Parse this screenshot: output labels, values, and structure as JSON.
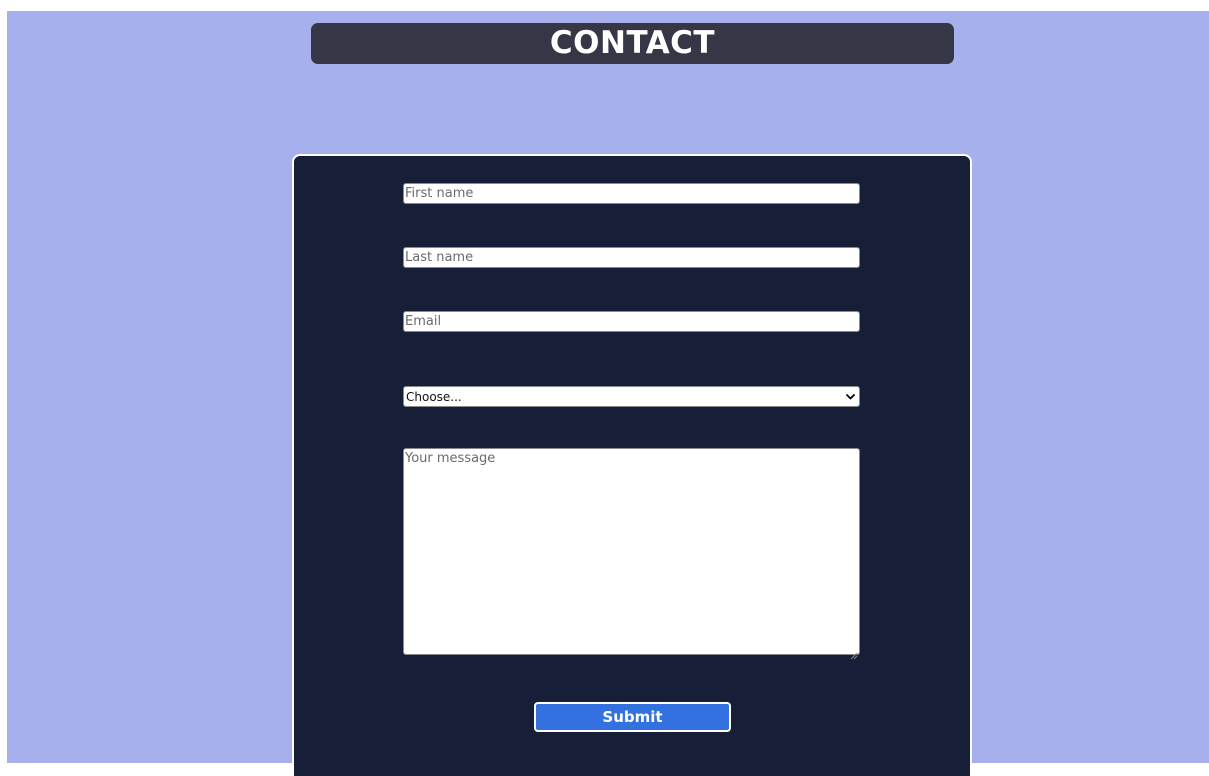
{
  "header": {
    "title": "CONTACT"
  },
  "form": {
    "first_name_placeholder": "First name",
    "last_name_placeholder": "Last name",
    "email_placeholder": "Email",
    "select_value": "Choose...",
    "message_placeholder": "Your message",
    "submit_label": "Submit"
  },
  "colors": {
    "page_background": "#a5b0ec",
    "title_bar": "#353646",
    "form_card": "#171e37",
    "submit_button": "#3370e0"
  },
  "icons": {
    "select_arrow": "chevron-down-icon",
    "textarea_resize": "resize-handle-icon"
  }
}
